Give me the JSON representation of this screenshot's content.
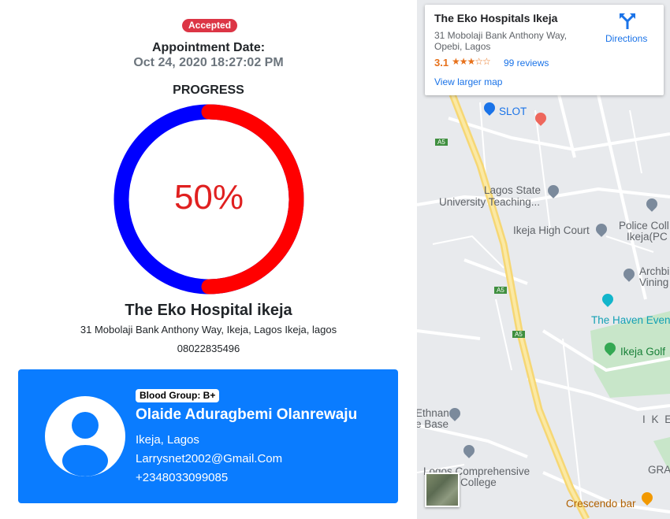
{
  "appointment": {
    "status": "Accepted",
    "date_label": "Appointment Date:",
    "date_value": "Oct 24, 2020 18:27:02 PM"
  },
  "progress": {
    "title": "PROGRESS",
    "percent_text": "50%",
    "value": 0.5,
    "colors": {
      "done": "#ff0000",
      "remaining": "#0000ff",
      "text": "#e02020"
    }
  },
  "hospital": {
    "name": "The Eko Hospital ikeja",
    "address": "31 Mobolaji Bank Anthony Way, Ikeja, Lagos Ikeja, lagos",
    "phone": "08022835496"
  },
  "patient": {
    "blood_group": "Blood Group: B+",
    "name": "Olaide Aduragbemi Olanrewaju",
    "location": "Ikeja, Lagos",
    "email": "Larrysnet2002@Gmail.Com",
    "phone": "+2348033099085",
    "card_color": "#0a7cff"
  },
  "map": {
    "place_title": "The Eko Hospitals Ikeja",
    "address_line1": "31 Mobolaji Bank Anthony Way,",
    "address_line2": "Opebi, Lagos",
    "rating": "3.1",
    "stars": "★★★☆☆",
    "reviews": "99 reviews",
    "larger_map": "View larger map",
    "directions": "Directions",
    "labels": {
      "slot": "SLOT",
      "lasu1": "Lagos State",
      "lasu2": "University Teaching...",
      "high_court": "Ikeja High Court",
      "police1": "Police Coll",
      "police2": "Ikeja(PC",
      "archbi1": "Archbi",
      "archbi2": "Vining",
      "haven": "The Haven Even",
      "golf": "Ikeja Golf",
      "ethnan1": "Ethnan",
      "ethnan2": "e Base",
      "comp1": "Logos Comprehensive",
      "comp2": "College",
      "crescendo": "Crescendo bar",
      "ikeja_area": "I K E",
      "gra": "GRA",
      "road_a5_1": "A5",
      "road_a5_2": "A5",
      "road_a5_3": "A5"
    }
  }
}
